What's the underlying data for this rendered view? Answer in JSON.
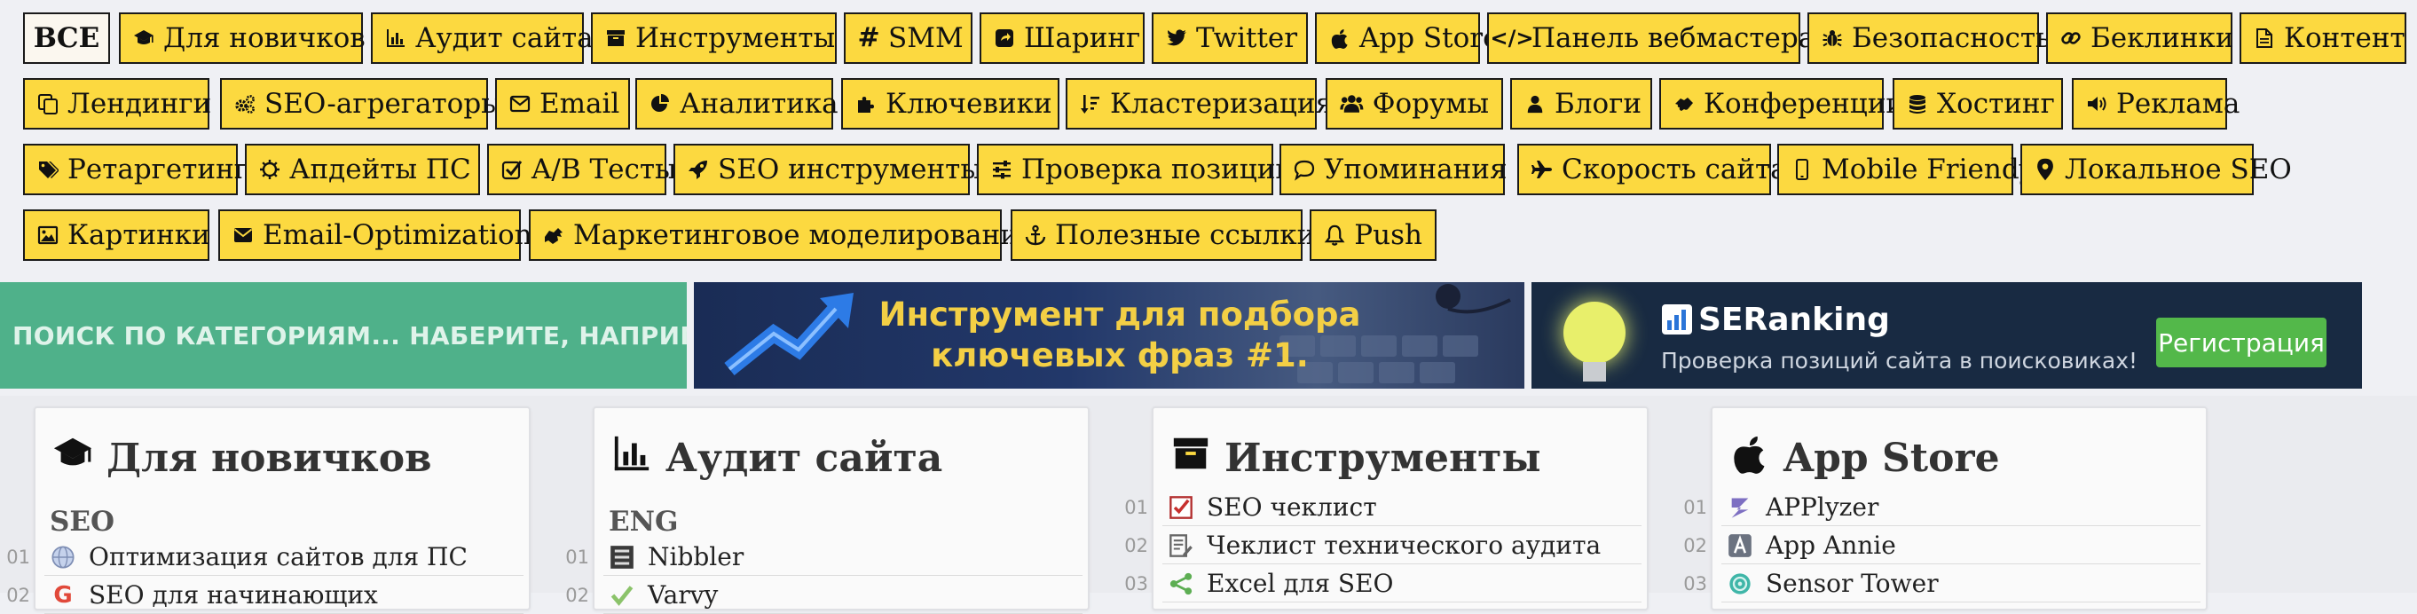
{
  "tags": [
    {
      "key": "all",
      "label": "ВСЕ",
      "icon": ""
    },
    {
      "key": "newbies",
      "label": "Для новичков",
      "icon": "graduation-cap-icon"
    },
    {
      "key": "audit",
      "label": "Аудит сайта",
      "icon": "bar-chart-icon"
    },
    {
      "key": "tools",
      "label": "Инструменты",
      "icon": "archive-box-icon"
    },
    {
      "key": "smm",
      "label": "SMM",
      "icon": "hashtag-icon"
    },
    {
      "key": "sharing",
      "label": "Шаринг",
      "icon": "share-square-icon"
    },
    {
      "key": "twitter",
      "label": "Twitter",
      "icon": "twitter-bird-icon"
    },
    {
      "key": "appstore",
      "label": "App Store",
      "icon": "apple-icon"
    },
    {
      "key": "webmaster",
      "label": "Панель вебмастера",
      "icon": "code-icon"
    },
    {
      "key": "security",
      "label": "Безопасность",
      "icon": "bug-icon"
    },
    {
      "key": "backlinks",
      "label": "Беклинки",
      "icon": "link-icon"
    },
    {
      "key": "content",
      "label": "Контент",
      "icon": "document-icon"
    },
    {
      "key": "landings",
      "label": "Лендинги",
      "icon": "copy-icon"
    },
    {
      "key": "seo-aggregators",
      "label": "SEO-агрегаторы",
      "icon": "gears-icon"
    },
    {
      "key": "email",
      "label": "Email",
      "icon": "envelope-icon"
    },
    {
      "key": "analytics",
      "label": "Аналитика",
      "icon": "pie-chart-icon"
    },
    {
      "key": "keywords",
      "label": "Ключевики",
      "icon": "puzzle-icon"
    },
    {
      "key": "clustering",
      "label": "Кластеризация",
      "icon": "sort-amount-icon"
    },
    {
      "key": "forums",
      "label": "Форумы",
      "icon": "users-icon"
    },
    {
      "key": "blogs",
      "label": "Блоги",
      "icon": "user-icon"
    },
    {
      "key": "conferences",
      "label": "Конференции",
      "icon": "handshake-icon"
    },
    {
      "key": "hosting",
      "label": "Хостинг",
      "icon": "database-icon"
    },
    {
      "key": "ads",
      "label": "Реклама",
      "icon": "speaker-icon"
    },
    {
      "key": "retargeting",
      "label": "Ретаргетинг",
      "icon": "tags-icon"
    },
    {
      "key": "updates",
      "label": "Апдейты ПС",
      "icon": "sun-gear-icon"
    },
    {
      "key": "abtests",
      "label": "A/B Тесты",
      "icon": "checkbox-icon"
    },
    {
      "key": "seotools",
      "label": "SEO инструменты",
      "icon": "rocket-icon"
    },
    {
      "key": "positions",
      "label": "Проверка позиций",
      "icon": "sliders-icon"
    },
    {
      "key": "mentions",
      "label": "Упоминания",
      "icon": "comment-icon"
    },
    {
      "key": "speed",
      "label": "Скорость сайта",
      "icon": "plane-icon"
    },
    {
      "key": "mobile",
      "label": "Mobile Friendy",
      "icon": "mobile-icon"
    },
    {
      "key": "localseo",
      "label": "Локальное SEO",
      "icon": "map-marker-icon"
    },
    {
      "key": "images",
      "label": "Картинки",
      "icon": "image-icon"
    },
    {
      "key": "email-opt",
      "label": "Email-Optimization",
      "icon": "envelope-filled-icon"
    },
    {
      "key": "marketing",
      "label": "Маркетинговое моделирование",
      "icon": "hand-icon"
    },
    {
      "key": "links",
      "label": "Полезные ссылки",
      "icon": "anchor-icon"
    },
    {
      "key": "push",
      "label": "Push",
      "icon": "bell-icon"
    }
  ],
  "banners": {
    "search_text": "ПОИСК ПО КАТЕГОРИЯМ... НАБЕРИТЕ, НАПРИМЕР",
    "keywords_text": "Инструмент для подбора ключевых фраз #1.",
    "seranking_logo": "SERanking",
    "seranking_tagline": "Проверка позиций сайта в поисковиках!",
    "seranking_button": "Регистрация"
  },
  "cards": [
    {
      "title": "Для новичков",
      "icon": "graduation-cap-icon",
      "subheading": "SEO",
      "items": [
        {
          "num": "01",
          "label": "Оптимизация сайтов для ПС",
          "icon": "globe-icon"
        },
        {
          "num": "02",
          "label": "SEO для начинающих",
          "icon": "google-icon"
        }
      ]
    },
    {
      "title": "Аудит сайта",
      "icon": "bar-chart-icon",
      "subheading": "ENG",
      "items": [
        {
          "num": "01",
          "label": "Nibbler",
          "icon": "nibbler-icon"
        },
        {
          "num": "02",
          "label": "Varvy",
          "icon": "check-icon"
        }
      ]
    },
    {
      "title": "Инструменты",
      "icon": "archive-box-icon",
      "subheading": "",
      "items": [
        {
          "num": "01",
          "label": "SEO чеклист",
          "icon": "checklist-icon"
        },
        {
          "num": "02",
          "label": "Чеклист технического аудита",
          "icon": "doc-edit-icon"
        },
        {
          "num": "03",
          "label": "Excel для SEO",
          "icon": "share-nodes-icon"
        }
      ]
    },
    {
      "title": "App Store",
      "icon": "apple-icon",
      "subheading": "",
      "items": [
        {
          "num": "01",
          "label": "APPlyzer",
          "icon": "applyzer-icon"
        },
        {
          "num": "02",
          "label": "App Annie",
          "icon": "app-annie-icon"
        },
        {
          "num": "03",
          "label": "Sensor Tower",
          "icon": "sensor-tower-icon"
        }
      ]
    }
  ]
}
